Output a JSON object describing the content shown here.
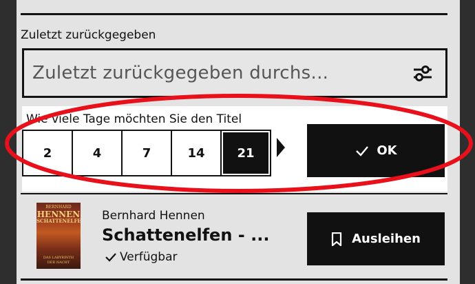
{
  "recent_returns": {
    "label": "Zuletzt zurückgegeben",
    "search_placeholder": "Zuletzt zurückgegeben durchs...",
    "filter_icon": "sliders-icon"
  },
  "loan_days": {
    "question": "Wie viele Tage möchten Sie den Titel",
    "options": [
      "2",
      "4",
      "7",
      "14",
      "21"
    ],
    "selected": "21",
    "confirm_label": "OK",
    "confirm_icon": "check-icon"
  },
  "book": {
    "cover": {
      "author": "BERNHARD",
      "title_line1": "HENNEN",
      "title_line2": "SCHATTENELFEN",
      "subtitle_line1": "DAS LABYRINTH",
      "subtitle_line2": "DER NACHT"
    },
    "author": "Bernhard Hennen",
    "title": "Schattenelfen - ...",
    "status": "Verfügbar",
    "status_icon": "check-icon",
    "borrow_label": "Ausleihen",
    "borrow_icon": "bookmark-icon"
  },
  "annotation": {
    "shape": "ellipse",
    "color": "#e8101a"
  }
}
